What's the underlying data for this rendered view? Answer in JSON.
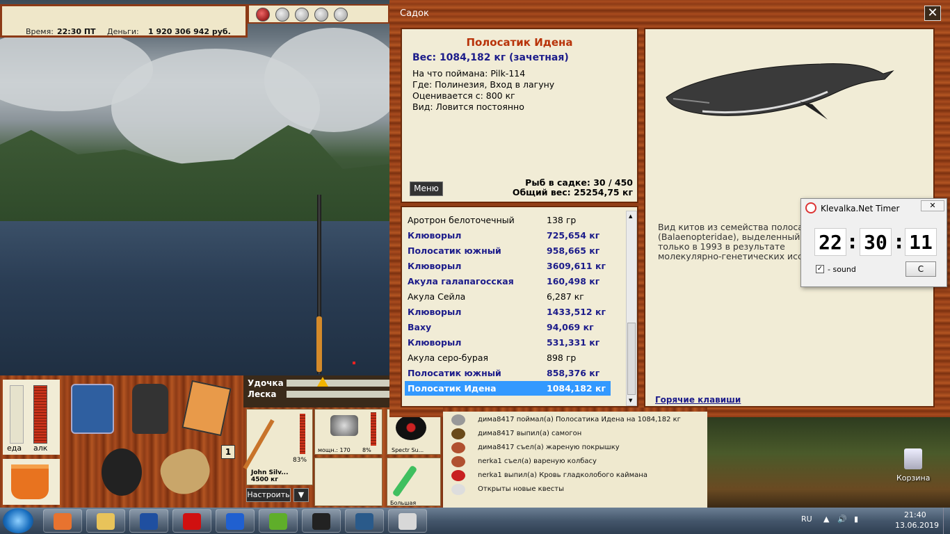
{
  "game": {
    "time_label": "Время:",
    "time_value": "22:30 ПТ",
    "money_label": "Деньги:",
    "money_value": "1 920 306 942 руб.",
    "food_label": "еда",
    "alc_label": "алк",
    "rod_label": "Удочка",
    "line_label": "Леска",
    "tackle": {
      "rod_name": "John Silv...",
      "rod_capacity": "4500 кг",
      "rod_percent": "83%",
      "reel_power": "мощн.: 170",
      "reel_percent": "8%",
      "line_name": "Spectr Su...",
      "lure_name": "Большая"
    },
    "count_badge": "1",
    "setup_button": "Настроить",
    "down_arrow": "▼"
  },
  "dialog": {
    "title": "Садок",
    "close_symbol": "✕",
    "fish": {
      "name": "Полосатик Идена",
      "weight": "Вес: 1084,182 кг (зачетная)",
      "caught_on": "На что поймана: Pilk-114",
      "where": "Где: Полинезия, Вход в лагуну",
      "valued_from": "Оценивается с: 800 кг",
      "kind": "Вид: Ловится постоянно"
    },
    "menu_button": "Меню",
    "fish_in_net": "Рыб в садке: 30 / 450",
    "total_weight": "Общий вес: 25254,75 кг",
    "catch_list": [
      {
        "name": "Аротрон белоточечный",
        "weight": "138 гр",
        "bold": false
      },
      {
        "name": "Клюворыл",
        "weight": "725,654 кг",
        "bold": true
      },
      {
        "name": "Полосатик южный",
        "weight": "958,665 кг",
        "bold": true
      },
      {
        "name": "Клюворыл",
        "weight": "3609,611 кг",
        "bold": true
      },
      {
        "name": "Акула галапагосская",
        "weight": "160,498 кг",
        "bold": true
      },
      {
        "name": "Акула Сейла",
        "weight": "6,287 кг",
        "bold": false
      },
      {
        "name": "Клюворыл",
        "weight": "1433,512 кг",
        "bold": true
      },
      {
        "name": "Ваху",
        "weight": "94,069 кг",
        "bold": true
      },
      {
        "name": "Клюворыл",
        "weight": "531,331 кг",
        "bold": true
      },
      {
        "name": "Акула серо-бурая",
        "weight": "898 гр",
        "bold": false
      },
      {
        "name": "Полосатик южный",
        "weight": "858,376 кг",
        "bold": true
      },
      {
        "name": "Полосатик Идена",
        "weight": "1084,182 кг",
        "bold": true,
        "selected": true
      }
    ],
    "description": [
      "Вид китов из семейства полосат",
      "(Balaenopteridae), выделенный",
      "только в 1993 в результате",
      "молекулярно-генетических иссл"
    ],
    "hotkeys_link": "Горячие клавиши"
  },
  "timer": {
    "title": "Klevalka.Net Timer",
    "close_symbol": "✕",
    "hours": "22",
    "minutes": "30",
    "seconds": "11",
    "sound_label": "- sound",
    "sound_checked": true,
    "button_label": "C"
  },
  "chat": [
    {
      "text": "дима8417 поймал(а) Полосатика Идена на 1084,182 кг",
      "icon": "fish-icon"
    },
    {
      "text": "дима8417 выпил(а) самогон",
      "icon": "bottle-icon"
    },
    {
      "text": "дима8417 съел(а) жареную покрышку",
      "icon": "food-icon"
    },
    {
      "text": "nerka1 съел(а) вареную колбасу",
      "icon": "food-icon"
    },
    {
      "text": "nerka1 выпил(а) Кровь гладколобого каймана",
      "icon": "potion-icon"
    },
    {
      "text": "Открыты новые квесты",
      "icon": "clock-icon"
    }
  ],
  "desktop": {
    "recycle_bin_label": "Корзина"
  },
  "taskbar": {
    "language": "RU",
    "clock_time": "21:40",
    "clock_date": "13.06.2019",
    "apps": [
      "media-player-icon",
      "file-explorer-icon",
      "floppy-save-icon",
      "opera-icon",
      "butterfly-icon",
      "utorrent-icon",
      "p3-icon",
      "window-app-icon",
      "klevalka-timer-icon"
    ]
  },
  "colors": {
    "wood": "#8c3a15",
    "panel_beige": "#f1ecd6",
    "fish_title": "#b8330a",
    "bold_blue": "#1c1c8a",
    "selection": "#3399ff"
  }
}
